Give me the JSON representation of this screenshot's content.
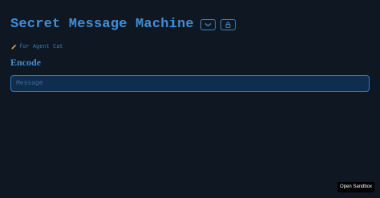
{
  "app": {
    "title": "Secret Message Machine",
    "subtitle": "for Agent Cat",
    "subtitle_icon": "pencil-emoji"
  },
  "toolbar": {
    "buttons": [
      {
        "icon": "chevron-down-icon"
      },
      {
        "icon": "lock-icon"
      }
    ]
  },
  "encode": {
    "heading": "Encode",
    "input_placeholder": "Message",
    "input_value": ""
  },
  "sandbox": {
    "label": "Open Sandbox"
  },
  "colors": {
    "background": "#0f1822",
    "accent": "#3d8fdb",
    "input_background": "#0f2d4c",
    "input_border": "#2f7dc6"
  }
}
